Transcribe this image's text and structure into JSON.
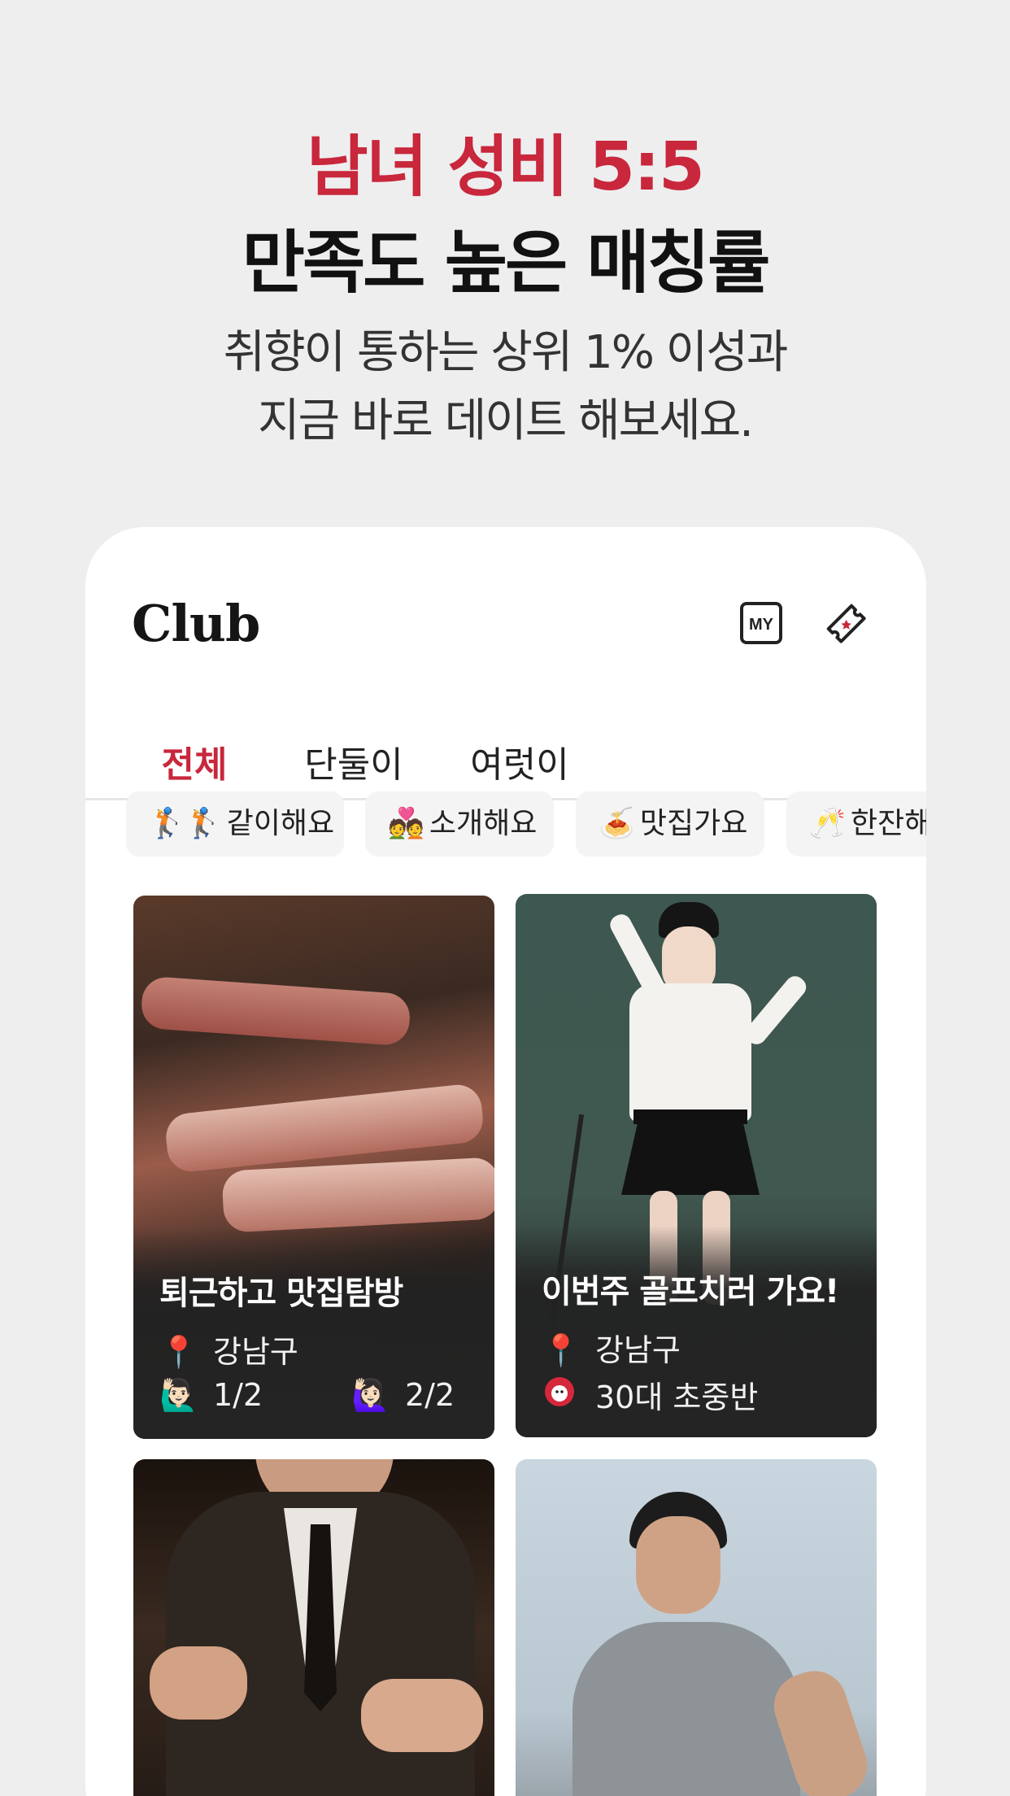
{
  "hero": {
    "line1": "남녀 성비 5:5",
    "line2": "만족도 높은 매칭률",
    "sub1": "취향이 통하는 상위 1% 이성과",
    "sub2": "지금 바로 데이트 해보세요."
  },
  "header": {
    "title": "Club",
    "my_icon_label": "MY"
  },
  "tabs": [
    {
      "label": "전체",
      "active": true
    },
    {
      "label": "단둘이",
      "active": false
    },
    {
      "label": "여럿이",
      "active": false
    }
  ],
  "chips": [
    {
      "emoji": "🏌️🏌️",
      "label": "같이해요"
    },
    {
      "emoji": "💑",
      "label": "소개해요"
    },
    {
      "emoji": "🍝",
      "label": "맛집가요"
    },
    {
      "emoji": "🥂",
      "label": "한잔해"
    }
  ],
  "cards": [
    {
      "title": "퇴근하고 맛집탐방",
      "location_icon": "📍",
      "location": "강남구",
      "male_icon": "🙋🏻‍♂️",
      "male_count": "1/2",
      "female_icon": "🙋🏻‍♀️",
      "female_count": "2/2"
    },
    {
      "title": "이번주 골프치러 가요!",
      "location_icon": "📍",
      "location": "강남구",
      "level_icon": "⛳",
      "level": "30대 초중반"
    }
  ],
  "colors": {
    "accent": "#c8273c",
    "background": "#eeeeef",
    "chip_bg": "#f4f4f4"
  }
}
